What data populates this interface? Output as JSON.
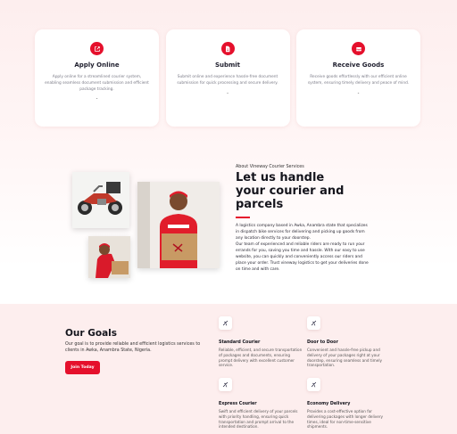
{
  "steps": [
    {
      "title": "Apply Online",
      "icon": "external-link-icon",
      "text": "Apply online for a streamlined courier system, enabling seamless document submission and efficient package tracking.",
      "dash": "-"
    },
    {
      "title": "Submit",
      "icon": "document-icon",
      "text": "Submit online and experience hassle-free document submission for quick processing and secure delivery.",
      "dash": "-"
    },
    {
      "title": "Receive Goods",
      "icon": "inbox-icon",
      "text": "Receive goods effortlessly with our efficient online system, ensuring timely delivery and peace of mind.",
      "dash": "-"
    }
  ],
  "about": {
    "eyebrow": "About Vineway Courier Services",
    "title": "Let us handle your courier and parcels",
    "para1": "A logistics company based in Awka, Anambra state that specializes in dispatch bike services for delivering and picking up goods from any location directly to your doorstep.",
    "para2": "Our team of experienced and reliable riders are ready to run your errands for you, saving you time and hassle. With our easy to use website, you can quickly and conveniently access our riders and place your order. Trust vineway logistics to get your deliveries done on time and with care."
  },
  "goals": {
    "title": "Our Goals",
    "intro": "Our goal is to provide reliable and efficient logistics services to clients in Awka, Anambra State, Nigeria.",
    "button": "Join Today",
    "services": [
      {
        "title": "Standard Courier",
        "icon": "plane-icon",
        "text": "Reliable, efficient, and secure transportation of packages and documents, ensuring prompt delivery with excellent customer service."
      },
      {
        "title": "Door to Door",
        "icon": "plane-icon",
        "text": "Convenient and hassle-free pickup and delivery of your packages right at your doorstep, ensuring seamless and timely transportation."
      },
      {
        "title": "Express Courier",
        "icon": "plane-icon",
        "text": "Swift and efficient delivery of your parcels with priority handling, ensuring quick transportation and prompt arrival to the intended destination."
      },
      {
        "title": "Economy Delivery",
        "icon": "plane-icon",
        "text": "Provides a cost-effective option for delivering packages with longer delivery times, ideal for non-time-sensitive shipments."
      }
    ]
  },
  "colors": {
    "accent": "#e5102c",
    "page_background": "#fdeeee"
  }
}
